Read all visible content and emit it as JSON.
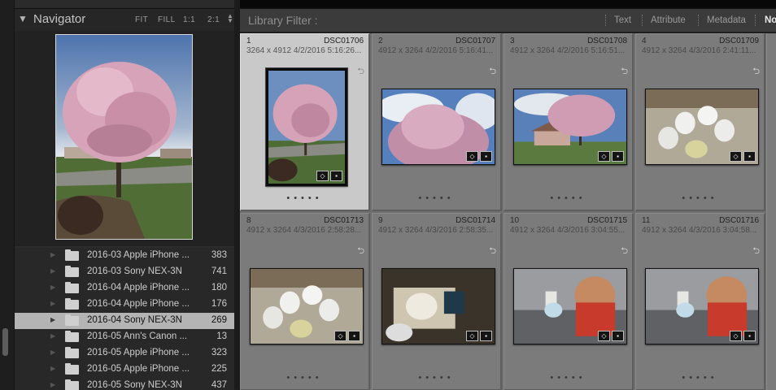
{
  "navigator": {
    "title": "Navigator",
    "zoom": [
      "FIT",
      "FILL",
      "1:1",
      "2:1"
    ]
  },
  "folders": [
    {
      "name": "2016-03 Apple iPhone ...",
      "count": "383",
      "selected": false
    },
    {
      "name": "2016-03 Sony NEX-3N",
      "count": "741",
      "selected": false
    },
    {
      "name": "2016-04 Apple iPhone ...",
      "count": "180",
      "selected": false
    },
    {
      "name": "2016-04 Apple iPhone ...",
      "count": "176",
      "selected": false
    },
    {
      "name": "2016-04 Sony NEX-3N",
      "count": "269",
      "selected": true
    },
    {
      "name": "2016-05 Ann's Canon ...",
      "count": "13",
      "selected": false
    },
    {
      "name": "2016-05 Apple iPhone ...",
      "count": "323",
      "selected": false
    },
    {
      "name": "2016-05 Apple iPhone ...",
      "count": "225",
      "selected": false
    },
    {
      "name": "2016-05 Sony NEX-3N",
      "count": "437",
      "selected": false
    }
  ],
  "filter_bar": {
    "label": "Library Filter :",
    "options": [
      "Text",
      "Attribute",
      "Metadata",
      "No"
    ]
  },
  "grid": {
    "cells": [
      {
        "index": "1",
        "filename": "DSC01706",
        "meta": "3264 x 4912   4/2/2016 5:16:26...",
        "scene": "tree-sky",
        "orientation": "portrait",
        "selected": true
      },
      {
        "index": "2",
        "filename": "DSC01707",
        "meta": "4912 x 3264   4/2/2016 5:16:41...",
        "scene": "blossom-sky",
        "orientation": "landscape",
        "selected": false
      },
      {
        "index": "3",
        "filename": "DSC01708",
        "meta": "4912 x 3264   4/2/2016 5:16:51...",
        "scene": "house-sky",
        "orientation": "landscape",
        "selected": false
      },
      {
        "index": "4",
        "filename": "DSC01709",
        "meta": "4912 x 3264   4/3/2016 2:41:11...",
        "scene": "kitchen",
        "orientation": "landscape",
        "selected": false
      },
      {
        "index": "8",
        "filename": "DSC01713",
        "meta": "4912 x 3264   4/3/2016 2:58:28...",
        "scene": "kitchen",
        "orientation": "landscape",
        "selected": false
      },
      {
        "index": "9",
        "filename": "DSC01714",
        "meta": "4912 x 3264   4/3/2016 2:58:35...",
        "scene": "dark-kitchen",
        "orientation": "landscape",
        "selected": false
      },
      {
        "index": "10",
        "filename": "DSC01715",
        "meta": "4912 x 3264   4/3/2016 3:04:55...",
        "scene": "sink",
        "orientation": "landscape",
        "selected": false
      },
      {
        "index": "11",
        "filename": "DSC01716",
        "meta": "4912 x 3264   4/3/2016 3:04:58...",
        "scene": "sink",
        "orientation": "landscape",
        "selected": false
      }
    ]
  }
}
